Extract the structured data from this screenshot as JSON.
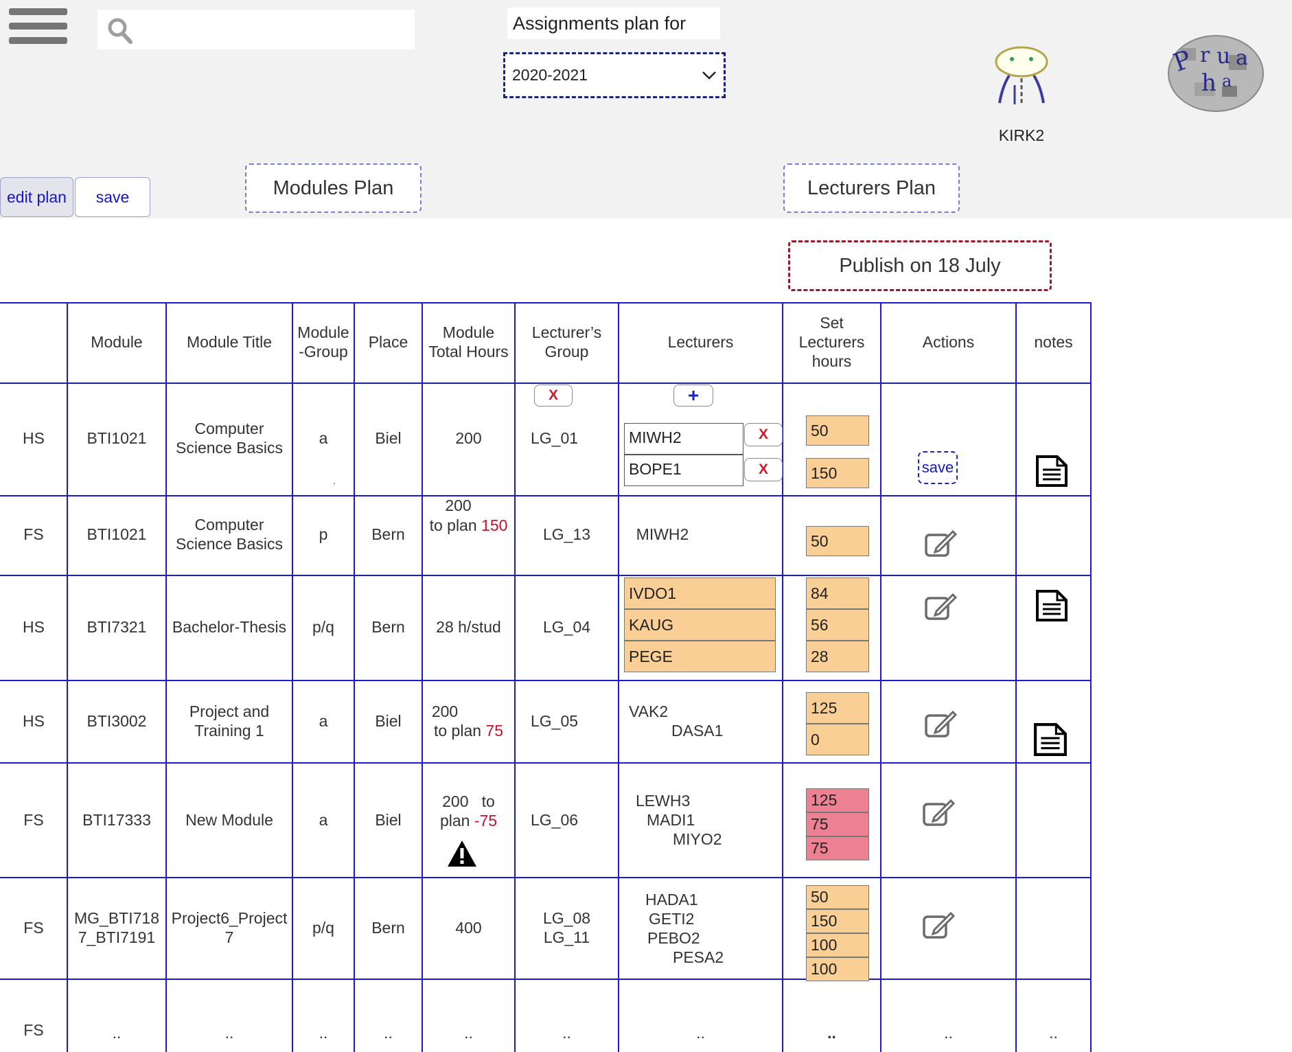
{
  "header": {
    "menu_icon": "hamburger-menu-icon",
    "search_icon": "search-icon",
    "search_placeholder": "",
    "title": "Assignments plan for",
    "year_selected": "2020-2021",
    "user_name": "KIRK2",
    "user_avatar_icon": "user-avatar-icon",
    "logo_icon": "app-logo-icon"
  },
  "toolbar": {
    "edit_plan_label": "edit  plan",
    "save_label": "save",
    "modules_plan_label": "Modules Plan",
    "lecturers_plan_label": "Lecturers Plan",
    "publish_label": "Publish on 18 July"
  },
  "table": {
    "columns": [
      "",
      "Module",
      "Module Title",
      "Module -Group",
      "Place",
      "Module Total Hours",
      "Lecturer’s Group",
      "Lecturers",
      "Set Lecturers hours",
      "Actions",
      "notes"
    ],
    "rows": [
      {
        "sem": "HS",
        "module": "BTI1021",
        "title": "Computer Science Basics",
        "group": "a",
        "place": "Biel",
        "hours_total": "200",
        "hours_label": "",
        "to_plan": "",
        "lg": "LG_01",
        "lecturers": [
          "MIWH2",
          "BOPE1"
        ],
        "set_hours": [
          "50",
          "150"
        ],
        "action": "save",
        "note": "document-icon"
      },
      {
        "sem": "FS",
        "module": "BTI1021",
        "title": "Computer Science Basics",
        "group": "p",
        "place": "Bern",
        "hours_total": "200",
        "hours_label": "to plan",
        "to_plan": "150",
        "lg": "LG_13",
        "lecturers": [
          "MIWH2"
        ],
        "set_hours": [
          "50"
        ],
        "action": "edit-icon",
        "note": ""
      },
      {
        "sem": "HS",
        "module": "BTI7321",
        "title": "Bachelor-Thesis",
        "group": "p/q",
        "place": "Bern",
        "hours_total": "28 h/stud",
        "hours_label": "",
        "to_plan": "",
        "lg": "LG_04",
        "lecturers": [
          "IVDO1",
          "KAUG",
          "PEGE"
        ],
        "set_hours": [
          "84",
          "56",
          "28"
        ],
        "action": "edit-icon",
        "note": "document-icon"
      },
      {
        "sem": "HS",
        "module": "BTI3002",
        "title": "Project and Training 1",
        "group": "a",
        "place": "Biel",
        "hours_total": "200",
        "hours_label": "to plan",
        "to_plan": "75",
        "lg": "LG_05",
        "lecturers": [
          "VAK2",
          "DASA1"
        ],
        "set_hours": [
          "125",
          "0"
        ],
        "action": "edit-icon",
        "note": "document-icon"
      },
      {
        "sem": "FS",
        "module": "BTI17333",
        "title": "New Module",
        "group": "a",
        "place": "Biel",
        "hours_total": "200",
        "hours_label": "to plan",
        "to_plan": "-75",
        "lg": "LG_06",
        "lecturers": [
          "LEWH3",
          "MADI1",
          "MIYO2"
        ],
        "set_hours": [
          "125",
          "75",
          "75"
        ],
        "action": "edit-icon",
        "note": "",
        "warning": "warning-icon"
      },
      {
        "sem": "FS",
        "module": "MG_BTI7187_BTI7191",
        "title": "Project6_Project7",
        "group": "p/q",
        "place": "Bern",
        "hours_total": "400",
        "hours_label": "",
        "to_plan": "",
        "lg": "LG_08 LG_11",
        "lecturers": [
          "HADA1",
          "GETI2",
          "PEBO2",
          "PESA2"
        ],
        "set_hours": [
          "50",
          "150",
          "100",
          "100"
        ],
        "action": "edit-icon",
        "note": ""
      },
      {
        "sem": "FS",
        "module": "..",
        "title": "..",
        "group": "..",
        "place": "..",
        "hours_total": "..",
        "hours_label": "",
        "to_plan": "",
        "lg": "..",
        "lecturers": [
          ".."
        ],
        "set_hours": [
          ".."
        ],
        "action": "..",
        "note": ".."
      }
    ],
    "row_remove_label": "X",
    "add_lecturer_label": "+",
    "cell_text": {
      "r0_lg": "LG_01",
      "r5_lg_a": "LG_08",
      "r5_lg_b": "LG_11",
      "r5_mod_a": "MG_BTI718",
      "r5_mod_b": "7_BTI7191",
      "r5_title_a": "Project6_Project",
      "r5_title_b": "7",
      "r3_hours_a": "200",
      "r4_hours_a": "200   to",
      "r4_plan_label": "plan",
      "title_line_cs1": "Computer",
      "title_line_cs2": "Science Basics",
      "title_line_pt1": "Project and",
      "title_line_pt2": "Training 1",
      "hdr_group_1": "Module",
      "hdr_group_2": "-Group",
      "hdr_total_1": "Module",
      "hdr_total_2": "Total Hours",
      "hdr_lg_1": "Lecturer’s",
      "hdr_lg_2": "Group",
      "hdr_set_1": "Set",
      "hdr_set_2": "Lecturers",
      "hdr_set_3": "hours",
      "dot": "."
    }
  },
  "colors": {
    "grid_line": "#1a1ad0",
    "hours_box": "#f9cf95",
    "hours_box_over": "#eb8193",
    "publish_border": "#9a1a2a",
    "link_blue": "#1515c8",
    "negative_red": "#c8102e"
  }
}
